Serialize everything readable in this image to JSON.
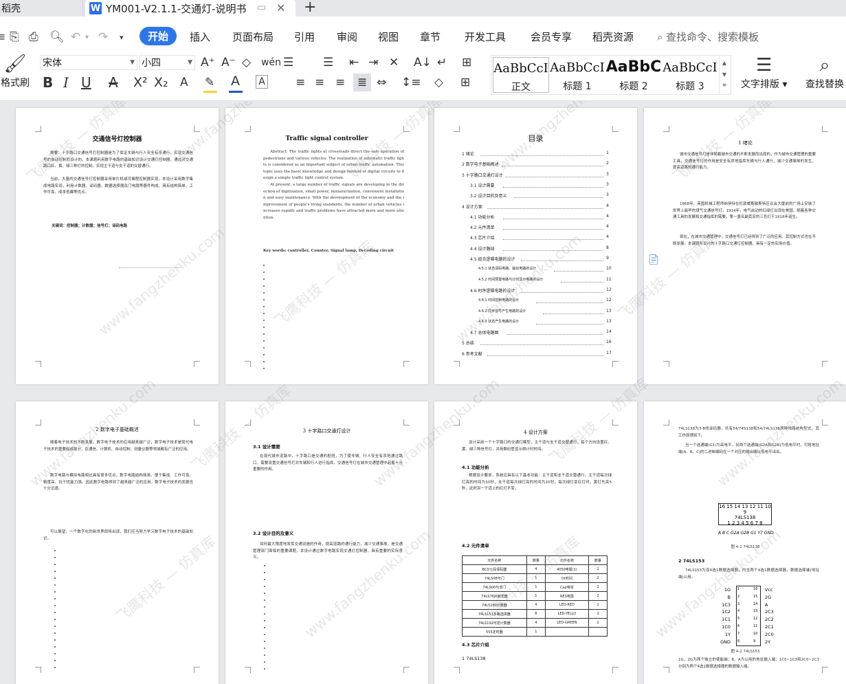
{
  "tabs": {
    "previous": "稻壳",
    "active_icon": "W",
    "active_title": "YM001-V2.1.1-交通灯-说明书",
    "add": "+"
  },
  "menu": {
    "items": [
      "开始",
      "插入",
      "页面布局",
      "引用",
      "审阅",
      "视图",
      "章节",
      "开发工具",
      "会员专享",
      "稻壳资源"
    ],
    "active_index": 0,
    "search": "查找命令、搜索模板"
  },
  "ribbon": {
    "format_painter": "格式刷",
    "font_name": "宋体",
    "font_size": "小四",
    "styles": [
      {
        "preview": "AaBbCcI",
        "label": "正文"
      },
      {
        "preview": "AaBbCcI",
        "label": "标题 1"
      },
      {
        "preview": "AaBbC",
        "label": "标题 2"
      },
      {
        "preview": "AaBbCcI",
        "label": "标题 3"
      }
    ],
    "text_layout": "文字排版",
    "find_replace": "查找替换",
    "colors": {
      "accent": "#2e76e8",
      "font_color_bar": "#2255cc",
      "highlight_bar": "#f7d22a"
    }
  },
  "pages": {
    "p1": {
      "title": "交通信号灯控制器",
      "abstract": "摘要：十字路口交通信号灯控制器是为了保证车辆与行人安全有序通行，实现交通信号的自动控制而设计的。本课题利用数字电路的基础知识设计交通灯控制器，通过对交通路口红、黄、绿三种灯的控制，实现主干道与支干道的交替通行。",
      "para2": "当前，大量的交通信号灯控制器采用单片机或可编程控制器实现，本设计采用数字集成电路实现，利用计数器、译码器、数据选择器及门电路等器件构成，具有结构简单、工作可靠、成本低廉等优点。",
      "keywords": "关键词：控制器；计数器；信号灯；译码电路"
    },
    "p2": {
      "title": "Traffic signal controller",
      "abstract": "Abstract: The traffic lights at crossroads direct the safe operation of pedestrians and various vehicles. The realization of automatic traffic lights is considered as an important subject of urban traffic automation. This topic uses the basic knowledge and design method of digital circuits to design a simple traffic light control system.",
      "para2": "At present, a large number of traffic signals are developing in the direction of digitization, small power, miniaturization, convenient installation and easy maintenance. With the development of the economy and the improvement of people's living standards, the number of urban vehicles increases rapidly and traffic problems have attracted more and more attention.",
      "keywords": "Key words: controller, Counter, Signal lamp, Decoding circuit"
    },
    "p3": {
      "title": "目录",
      "toc": [
        {
          "t": "1 绪论",
          "n": "1"
        },
        {
          "t": "2 数字电子基础概述",
          "n": "2"
        },
        {
          "t": "3 十字路口交通灯设计",
          "n": "3"
        },
        {
          "t": "3.1 设计需要",
          "n": "3"
        },
        {
          "t": "3.2 设计目的及意义",
          "n": "3"
        },
        {
          "t": "4 设计方案",
          "n": "4"
        },
        {
          "t": "4.1 功能分析",
          "n": "4"
        },
        {
          "t": "4.2 元件清单",
          "n": "4"
        },
        {
          "t": "4.3 芯片介绍",
          "n": "4"
        },
        {
          "t": "4.4 设计路线",
          "n": "8"
        },
        {
          "t": "4.5 组合逻辑电路的设计",
          "n": "9"
        },
        {
          "t": "4.5.1 状态译码电路、输出电路的设计",
          "n": "10"
        },
        {
          "t": "4.5.2 时间预置电路与计时显示电路的设计",
          "n": "11"
        },
        {
          "t": "4.6 时序逻辑电路的设计",
          "n": "12"
        },
        {
          "t": "4.6.1 时间控制电路的设计",
          "n": "12"
        },
        {
          "t": "4.6.2 同步信号产生电路的设计",
          "n": "13"
        },
        {
          "t": "4.6.3 状态产生电路的设计",
          "n": "13"
        },
        {
          "t": "4.7 总体电路图",
          "n": "14"
        },
        {
          "t": "5 总结",
          "n": "16"
        },
        {
          "t": "6 参考文献",
          "n": "17"
        }
      ]
    },
    "p4": {
      "title": "1 绪论",
      "para1": "城市交通信号灯是伴随着城市交通的不断发展而出现的，作为城市交通管理的重要工具，交通信号灯的作用是安全有序地指挥车辆与行人通行，减少交通事故的发生，提高道路的通行能力。",
      "para2": "1868年，英国机械工程师纳伊特在伦敦威斯敏斯特区议会大厦前的广场上安装了世界上最早的煤气交通信号灯，1914年，电气启动的红绿灯出现在美国。随着各种交通工具的发展和交通指挥的需要，第一盏名副其实的三色灯于1918年诞生。",
      "para3": "现在，在城市交通管理中，交通信号灯已经得到了广泛的应用，其控制方式也在不断发展，本课题所设计的十字路口交通灯控制器，具有一定的实用价值。"
    },
    "p5": {
      "title": "2 数字电子基础概述",
      "para1": "随着电子技术的不断发展，数字电子技术的应用越来越广泛，数字电子技术是现代电子技术的重要组成部分，在通信、计算机、自动控制、测量仪器等领域都有广泛的应用。",
      "para2": "数字电路与模拟电路相比具有很多优点，数字电路结构简单、便于集成、工作可靠、精度高、抗干扰能力强，因此数字电路得到了越来越广泛的应用，数字电子技术的发展也十分迅速。",
      "para3": "可以展望，一个数字化的新世界即将出现，我们应当努力学习数字电子技术的基础知识。"
    },
    "p6": {
      "title": "3 十字路口交通灯设计",
      "h1": "3.1 设计需要",
      "para1": "在现代城市道路中，十字路口是交通的枢纽，为了使车辆、行人安全有序地通过路口，需要设置交通信号灯对车辆和行人进行指挥，交通信号灯在城市交通管理中起着十分重要的作用。",
      "h2": "3.2 设计目的及意义",
      "para2": "如何最大限度地发挥交通设施的作用，提高道路的通行能力，减少交通事故，是交通管理部门面临的重要课题，本设计通过数字电路实现交通灯控制器，具有重要的实际意义。"
    },
    "p7": {
      "title": "4 设计方案",
      "para0": "设计采用一个十字路口的交通灯模型，主干道与支干道交替通行，每个方向设置红、黄、绿三种信号灯，并用数码管显示倒计时时间。",
      "h1": "4.1 功能分析",
      "para1": "根据设计要求，系统应具有以下基本功能：主干道和支干道交替通行，主干道每次绿灯亮的时间为30秒，支干道每次绿灯亮的时间为20秒，每次绿灯变红灯时，黄灯先亮5秒，此时另一干道上的红灯不变。",
      "h2": "4.2 元件清单",
      "table_head": [
        "元件名称",
        "数量",
        "元件名称",
        "数量"
      ],
      "table_rows": [
        [
          "BCD七段译码器",
          "4",
          "4050电阻(1)",
          "2"
        ],
        [
          "74LS08与门",
          "1",
          "Or时间",
          "2"
        ],
        [
          "74LS00与非门",
          "1",
          "Cap电容",
          "2"
        ],
        [
          "74LS76JK触发器",
          "1",
          "RES电阻",
          "2"
        ],
        [
          "74LS160计数器",
          "4",
          "LED-RED",
          "2"
        ],
        [
          "74LS153多路选择器",
          "8",
          "LED-YELLO",
          "2"
        ],
        [
          "74LS192可逆计数器",
          "4",
          "LED-GREEN",
          "2"
        ],
        [
          "555定时器",
          "1",
          "",
          ""
        ]
      ],
      "h3": "4.3 芯片介绍",
      "h4": "1 74LS138"
    },
    "p8": {
      "para1": "74LS138为3-8线译码器，共有54/74S138和54/74LS138两种线路结构型式，其工作原理如下。",
      "para2": "当一个选通端(G1)为高电平，另两个选通端(G2A和G2B)为低电平时，可将地址端(A、B、C)的二进制编码在一个对应的输出端以低电平译出。",
      "fig1_caption": "图 4-1 74LS138",
      "h2": "2 74LS153",
      "para3": "74LS153为双4选1数据选择器，内含两个4选1数据选择器，数据选择端(地址端)公用。",
      "fig2_caption": "图 4-2 74LS153",
      "para4": "1G、2G为两个独立的使能端；B、A为公用的地址输入端；1C0~1C3和2C0~2C3分别为两个4选1数据选择器的数据输入端。",
      "chip1_top": "16 15 14 13 12 11 10 9",
      "chip1_name": "74LS138",
      "chip1_bottom": "1 2 3 4 5 6 7 8",
      "chip1_bottom_labels": "A B C G2A G2B G1 Y7 GND",
      "chip2_left": [
        "1G",
        "B",
        "1C3",
        "1C2",
        "1C1",
        "1C0",
        "1Y",
        "GND"
      ],
      "chip2_right": [
        "Vcc",
        "2G",
        "A",
        "2C3",
        "2C2",
        "2C1",
        "2C0",
        "2Y"
      ],
      "chip2_pins_left": [
        "1",
        "2",
        "3",
        "4",
        "5",
        "6",
        "7",
        "8"
      ],
      "chip2_pins_right": [
        "16",
        "15",
        "14",
        "13",
        "12",
        "11",
        "10",
        "9"
      ]
    }
  },
  "watermark": {
    "line1": "飞鹰科技 — 仿真库",
    "line2": "www.fangzhenku.com"
  }
}
